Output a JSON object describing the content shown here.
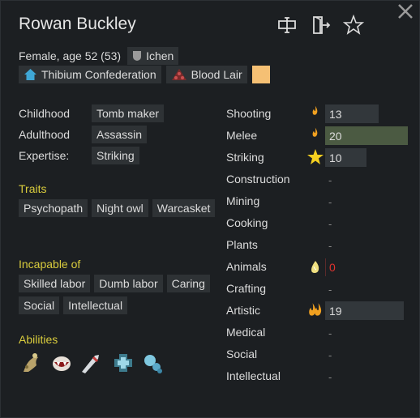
{
  "pawn": {
    "name": "Rowan Buckley",
    "description": "Female, age 52 (53)",
    "ideology": "Ichen",
    "faction": "Thibium Confederation",
    "xenotype": "Blood Lair",
    "favorite_color": "#f5c074"
  },
  "backstory": {
    "childhood_label": "Childhood",
    "childhood": "Tomb maker",
    "adulthood_label": "Adulthood",
    "adulthood": "Assassin",
    "expertise_label": "Expertise:",
    "expertise": "Striking"
  },
  "traits": {
    "heading": "Traits",
    "items": [
      "Psychopath",
      "Night owl",
      "Warcasket"
    ]
  },
  "incapable": {
    "heading": "Incapable of",
    "items": [
      "Skilled labor",
      "Dumb labor",
      "Caring",
      "Social",
      "Intellectual"
    ]
  },
  "abilities": {
    "heading": "Abilities",
    "icons": [
      "spore-ability-icon",
      "fang-ability-icon",
      "blade-ability-icon",
      "medic-ability-icon",
      "mechanite-ability-icon"
    ]
  },
  "skills": [
    {
      "name": "Shooting",
      "value": "13",
      "passion": "minor",
      "fill": 0.65
    },
    {
      "name": "Melee",
      "value": "20",
      "passion": "minor",
      "fill": 1.0
    },
    {
      "name": "Striking",
      "value": "10",
      "passion": "expertise",
      "fill": 0.5
    },
    {
      "name": "Construction",
      "value": "-",
      "passion": "none",
      "fill": 0
    },
    {
      "name": "Mining",
      "value": "-",
      "passion": "none",
      "fill": 0
    },
    {
      "name": "Cooking",
      "value": "-",
      "passion": "none",
      "fill": 0
    },
    {
      "name": "Plants",
      "value": "-",
      "passion": "none",
      "fill": 0
    },
    {
      "name": "Animals",
      "value": "0",
      "passion": "apathy",
      "fill": 0
    },
    {
      "name": "Crafting",
      "value": "-",
      "passion": "none",
      "fill": 0
    },
    {
      "name": "Artistic",
      "value": "19",
      "passion": "major",
      "fill": 0.95
    },
    {
      "name": "Medical",
      "value": "-",
      "passion": "none",
      "fill": 0
    },
    {
      "name": "Social",
      "value": "-",
      "passion": "none",
      "fill": 0
    },
    {
      "name": "Intellectual",
      "value": "-",
      "passion": "none",
      "fill": 0
    }
  ]
}
